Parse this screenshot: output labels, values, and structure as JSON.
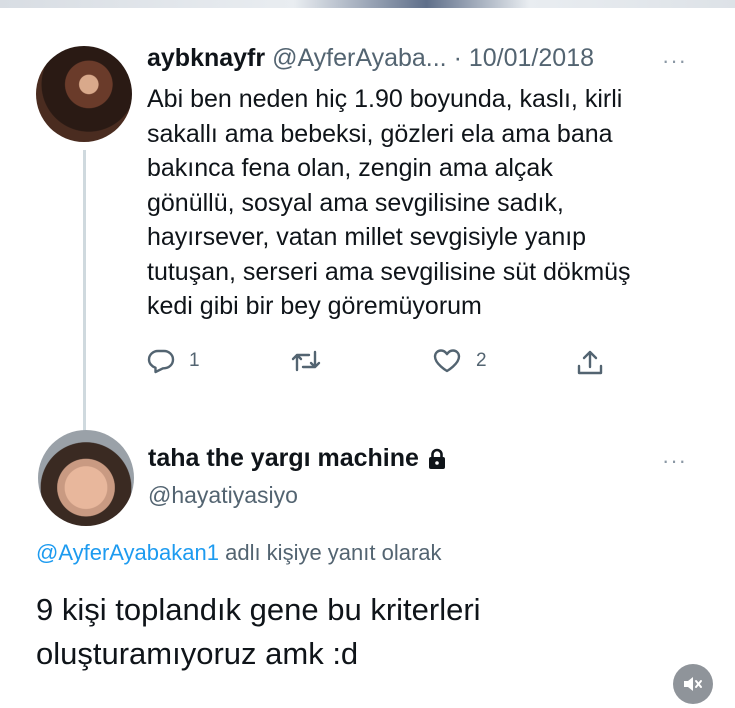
{
  "tweet1": {
    "display_name": "aybknayfr",
    "handle": "@AyferAyaba...",
    "separator": "·",
    "date": "10/01/2018",
    "more": "···",
    "text": "Abi ben neden hiç 1.90 boyunda, kaslı, kirli\nsakallı ama bebeksi, gözleri ela ama bana\nbakınca fena olan, zengin ama alçak\ngönüllü, sosyal ama sevgilisine sadık,\nhayırsever, vatan millet sevgisiyle yanıp\ntutuşan, serseri ama sevgilisine süt dökmüş\nkedi gibi bir bey göremüyorum",
    "actions": {
      "reply_count": "1",
      "retweet_count": "",
      "like_count": "2"
    }
  },
  "tweet2": {
    "display_name": "taha the yargı machine",
    "handle": "@hayatiyasiyo",
    "more": "···",
    "reply_mention": "@AyferAyabakan1",
    "reply_suffix": " adlı kişiye yanıt olarak",
    "text": "9 kişi toplandık gene bu kriterleri\noluşturamıyoruz amk :d"
  },
  "icons": {
    "reply": "comment-icon",
    "retweet": "retweet-icon",
    "like": "heart-icon",
    "share": "share-icon",
    "lock": "lock-icon",
    "mute": "speaker-muted-icon"
  },
  "colors": {
    "text": "#0f1419",
    "muted": "#536471",
    "link": "#1d9bf0",
    "thread_line": "#cfd9de"
  }
}
